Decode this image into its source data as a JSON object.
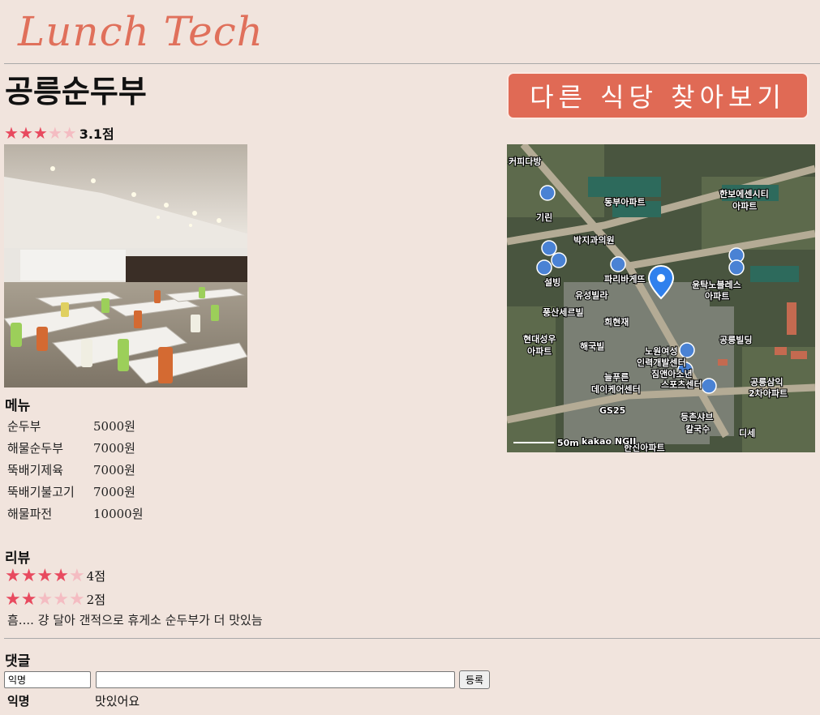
{
  "header": {
    "logo_text": "Lunch Tech"
  },
  "restaurant": {
    "name": "공릉순두부",
    "rating": {
      "stars": 3,
      "max": 5,
      "label": "3.1점"
    },
    "photo_alt": "restaurant-interior",
    "cta_label": "다른 식당 찾아보기"
  },
  "map": {
    "labels": [
      "커피다방",
      "동부아파트",
      "한보에센시티아파트",
      "기린",
      "박지과의원",
      "파리바게뜨",
      "설빙",
      "유성빌라",
      "윤탁노블레스아파트",
      "풍산세르빌",
      "희현재",
      "현대성우아파트",
      "해국빌",
      "공릉빌딩",
      "노원여성인력개발센터",
      "짐앤아소년스포츠센터",
      "늘푸른데이케어센터",
      "공릉삼익2차아파트",
      "GS25",
      "등촌샤브칼국수",
      "디세",
      "한진아파트"
    ],
    "scale_label": "50m",
    "attribution": "kakao NGII"
  },
  "menu": {
    "heading": "메뉴",
    "items": [
      {
        "name": "순두부",
        "price": "5000원"
      },
      {
        "name": "해물순두부",
        "price": "7000원"
      },
      {
        "name": "뚝배기제육",
        "price": "7000원"
      },
      {
        "name": "뚝배기불고기",
        "price": "7000원"
      },
      {
        "name": "해물파전",
        "price": "10000원"
      }
    ]
  },
  "reviews": {
    "heading": "리뷰",
    "items": [
      {
        "stars": 4,
        "label": "4점"
      },
      {
        "stars": 2,
        "label": "2점",
        "text": "흠.... 걍 달아 갠적으로 휴게소 순두부가 더 맛있늠"
      }
    ]
  },
  "comments": {
    "heading": "댓글",
    "author_value": "익명",
    "comment_value": "",
    "submit_label": "등록",
    "items": [
      {
        "author": "익명",
        "text": "맛있어요"
      }
    ]
  },
  "colors": {
    "background": "#f1e4dd",
    "accent": "#e06a55",
    "star_on": "#e84a5f",
    "star_off": "#f4bcc2"
  }
}
